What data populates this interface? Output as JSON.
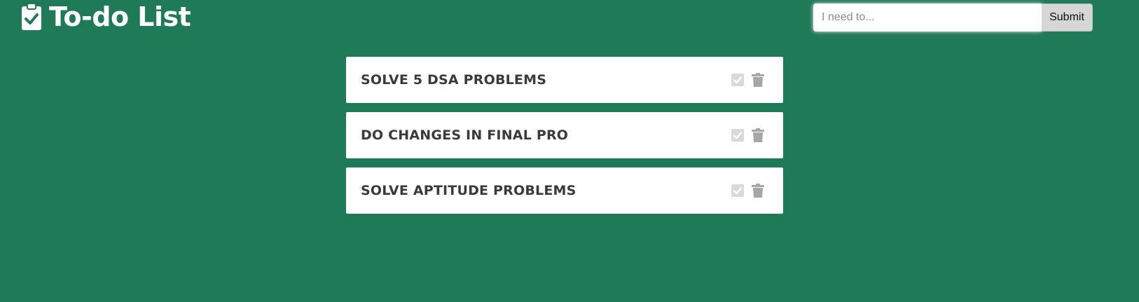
{
  "header": {
    "title": "To-do List",
    "icon": "clipboard-check-icon"
  },
  "form": {
    "placeholder": "I need to...",
    "value": "",
    "submit_label": "Submit"
  },
  "todos": [
    {
      "text": "SOLVE 5 DSA PROBLEMS",
      "completed": false
    },
    {
      "text": "DO CHANGES IN FINAL PRO",
      "completed": false
    },
    {
      "text": "SOLVE APTITUDE PROBLEMS",
      "completed": false
    }
  ],
  "item_icons": {
    "complete": "check-square-icon",
    "delete": "trash-icon"
  },
  "colors": {
    "background": "#1f7a57",
    "card": "#ffffff",
    "text": "#3a3a3a",
    "check_icon": "#d9d9d9",
    "trash_icon": "#a6a6a6",
    "submit_button": "#d6d6d6"
  }
}
